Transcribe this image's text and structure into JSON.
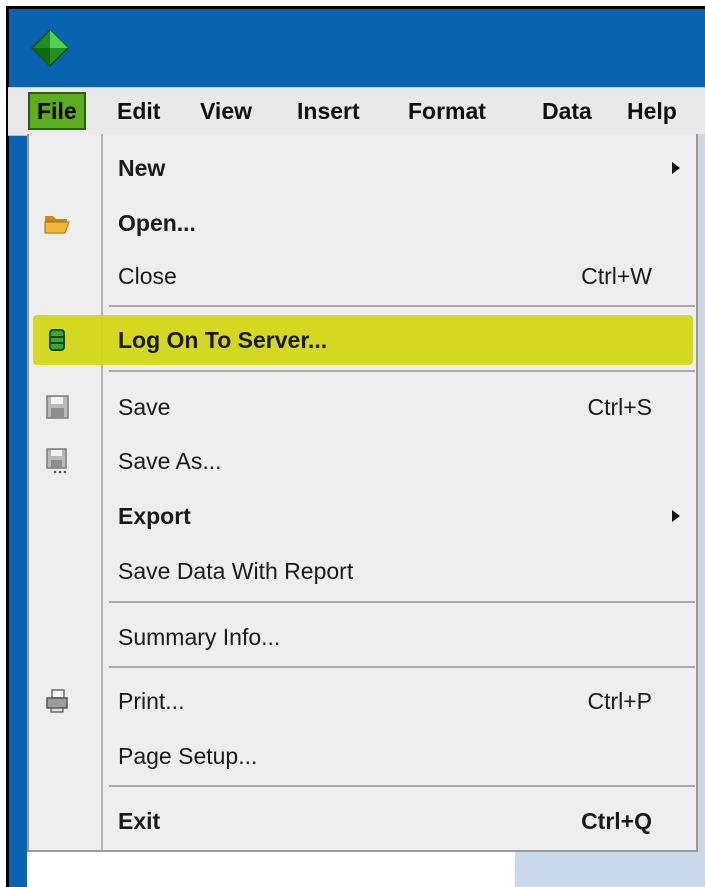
{
  "menubar": {
    "items": [
      "File",
      "Edit",
      "View",
      "Insert",
      "Format",
      "Data",
      "Help"
    ],
    "active": "File"
  },
  "file_menu": {
    "new": {
      "label": "New"
    },
    "open": {
      "label": "Open..."
    },
    "close": {
      "label": "Close",
      "shortcut": "Ctrl+W"
    },
    "log_on": {
      "label": "Log On To Server..."
    },
    "save": {
      "label": "Save",
      "shortcut": "Ctrl+S"
    },
    "save_as": {
      "label": "Save As..."
    },
    "export": {
      "label": "Export"
    },
    "save_data": {
      "label": "Save Data With Report"
    },
    "summary": {
      "label": "Summary Info..."
    },
    "print": {
      "label": "Print...",
      "shortcut": "Ctrl+P"
    },
    "page_setup": {
      "label": "Page Setup..."
    },
    "exit": {
      "label": "Exit",
      "shortcut": "Ctrl+Q"
    }
  },
  "icons": {
    "app": "green-diamond-icon",
    "open": "folder-open-icon",
    "log_on": "database-icon",
    "save": "floppy-disk-icon",
    "save_as": "floppy-disk-dots-icon",
    "print": "printer-icon"
  },
  "colors": {
    "titlebar": "#0a63b0",
    "active_menu": "#5aae1f",
    "highlight": "#d2d60e",
    "menu_bg": "#eeeeee"
  }
}
